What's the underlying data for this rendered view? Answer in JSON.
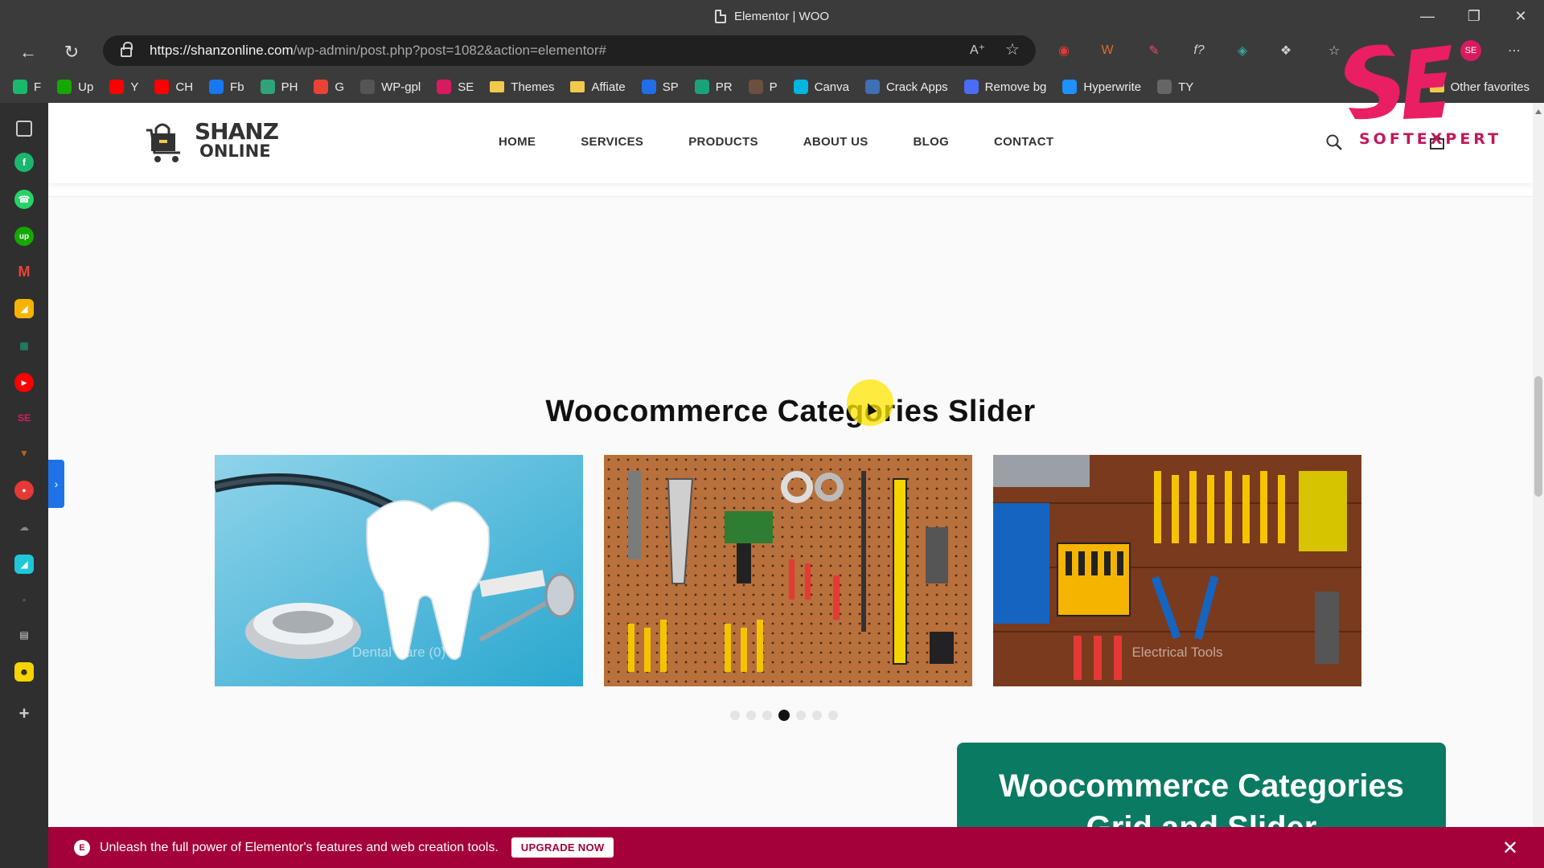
{
  "window": {
    "title": "Elementor | WOO"
  },
  "address_bar": {
    "url_host": "https://shanzonline.com",
    "url_path": "/wp-admin/post.php?post=1082&action=elementor#"
  },
  "bookmarks": [
    {
      "label": "F",
      "color": "#1bb76e"
    },
    {
      "label": "Up",
      "color": "#14a800"
    },
    {
      "label": "Y",
      "color": "#ff0000"
    },
    {
      "label": "CH",
      "color": "#ff0000"
    },
    {
      "label": "Fb",
      "color": "#1877f2"
    },
    {
      "label": "PH",
      "color": "#2fa37a"
    },
    {
      "label": "G",
      "color": "#ea4335"
    },
    {
      "label": "WP-gpl",
      "color": "#555555"
    },
    {
      "label": "SE",
      "color": "#d81b60"
    },
    {
      "label": "Themes",
      "color": "#f2c94c"
    },
    {
      "label": "Affiate",
      "color": "#f2c94c"
    },
    {
      "label": "SP",
      "color": "#1e6fe8"
    },
    {
      "label": "PR",
      "color": "#1aa37a"
    },
    {
      "label": "P",
      "color": "#6b4f3f"
    },
    {
      "label": "Canva",
      "color": "#00b5e2"
    },
    {
      "label": "Crack Apps",
      "color": "#3f6fb5"
    },
    {
      "label": "Remove bg",
      "color": "#4a6cf7"
    },
    {
      "label": "Hyperwrite",
      "color": "#1e90ff"
    },
    {
      "label": "TY",
      "color": "#666666"
    }
  ],
  "bookmarks_other": "Other favorites",
  "site": {
    "logo_line1": "SHANZ",
    "logo_line2": "ONLINE",
    "menu": [
      "HOME",
      "SERVICES",
      "PRODUCTS",
      "ABOUT US",
      "BLOG",
      "CONTACT"
    ]
  },
  "section": {
    "title": "Woocommerce Categories Slider",
    "slides": [
      {
        "caption": "Dental Care (0)",
        "theme": "dental"
      },
      {
        "caption": "",
        "theme": "pegboard"
      },
      {
        "caption": "Electrical Tools",
        "theme": "tools"
      }
    ],
    "dots_total": 7,
    "dots_active": 3
  },
  "callout": {
    "line1": "Woocommerce Categories",
    "line2": "Grid and Slider"
  },
  "promo": {
    "text": "Unleash the full power of Elementor's features and web creation tools.",
    "button": "UPGRADE NOW"
  },
  "watermark": {
    "text": "SOFTEXPERT"
  },
  "colors": {
    "callout": "#0b7a63",
    "promo": "#a4003a",
    "accent_blue": "#1e73e8"
  }
}
